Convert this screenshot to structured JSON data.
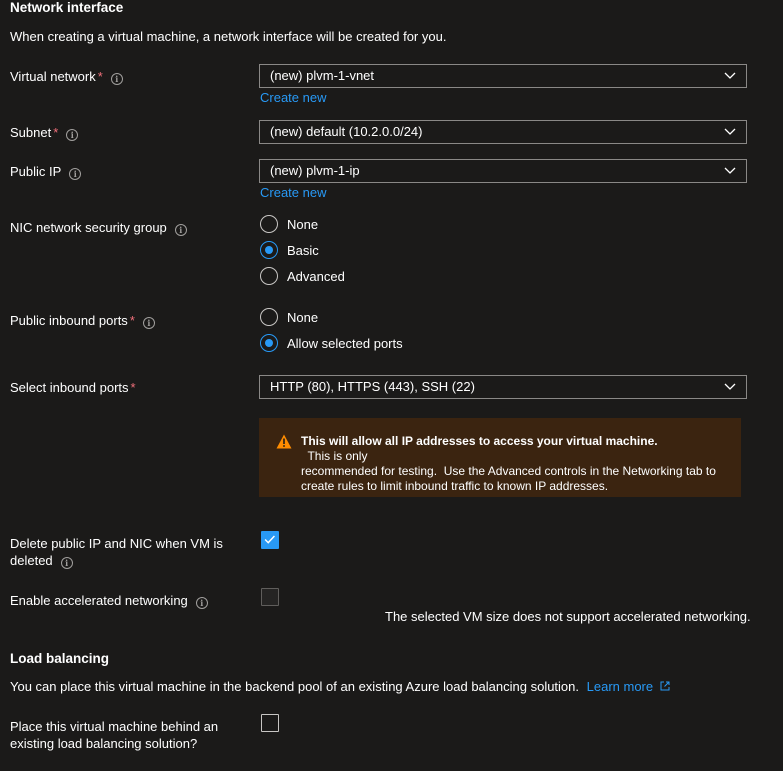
{
  "network_interface": {
    "title": "Network interface",
    "description": "When creating a virtual machine, a network interface will be created for you.",
    "virtual_network": {
      "label": "Virtual network",
      "value": "(new) plvm-1-vnet",
      "create_new": "Create new"
    },
    "subnet": {
      "label": "Subnet",
      "value": "(new) default (10.2.0.0/24)"
    },
    "public_ip": {
      "label": "Public IP",
      "value": "(new) plvm-1-ip",
      "create_new": "Create new"
    },
    "nic_nsg": {
      "label": "NIC network security group",
      "options": [
        "None",
        "Basic",
        "Advanced"
      ],
      "selected": "Basic"
    },
    "public_inbound_ports": {
      "label": "Public inbound ports",
      "options": [
        "None",
        "Allow selected ports"
      ],
      "selected": "Allow selected ports"
    },
    "select_inbound_ports": {
      "label": "Select inbound ports",
      "value": "HTTP (80), HTTPS (443), SSH (22)"
    },
    "warning": {
      "bold": "This will allow all IP addresses to access your virtual machine.",
      "line1_rest": "  This is only",
      "line2": "recommended for testing.  Use the Advanced controls in the Networking tab to",
      "line3": "create rules to limit inbound traffic to known IP addresses."
    },
    "delete_public_ip": {
      "label_line1": "Delete public IP and NIC when VM is",
      "label_line2": "deleted",
      "checked": true
    },
    "accelerated_networking": {
      "label": "Enable accelerated networking",
      "checked": false,
      "note": "The selected VM size does not support accelerated networking."
    }
  },
  "load_balancing": {
    "title": "Load balancing",
    "description": "You can place this virtual machine in the backend pool of an existing Azure load balancing solution.",
    "learn_more": "Learn more",
    "place_behind": {
      "label_line1": "Place this virtual machine behind an",
      "label_line2": "existing load balancing solution?",
      "checked": false
    }
  },
  "icons": {
    "info": "info-icon",
    "chevron": "chevron-down-icon",
    "warning": "warning-icon",
    "external": "external-link-icon",
    "check": "checkmark-icon"
  },
  "colors": {
    "background": "#1b1a19",
    "accent": "#2899f5",
    "required": "#f1707b",
    "warning_bg": "#3b2410",
    "warning_icon": "#ff8c00"
  }
}
